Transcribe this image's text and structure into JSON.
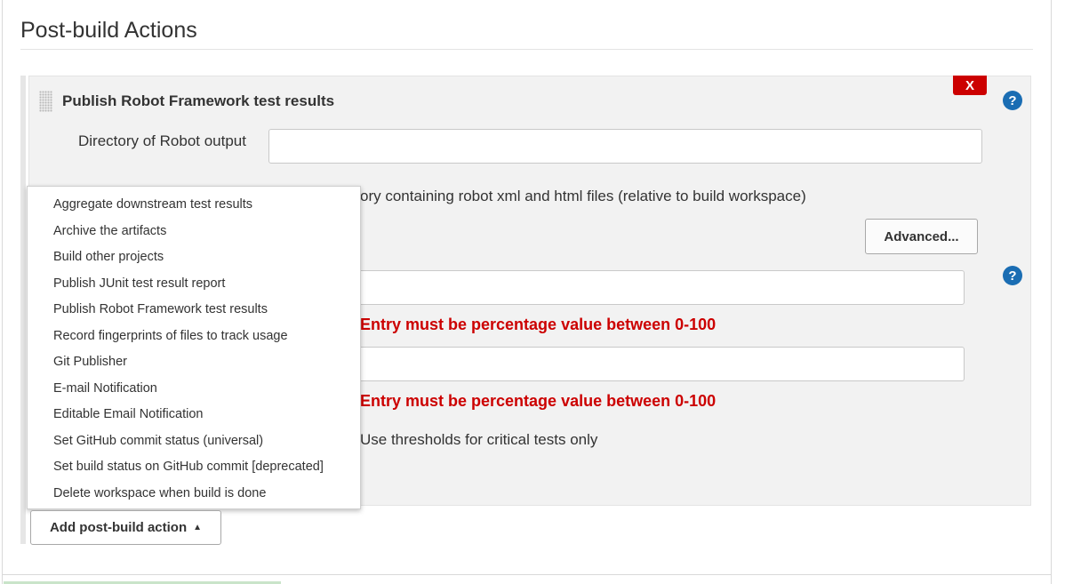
{
  "section": {
    "title": "Post-build Actions"
  },
  "panel": {
    "title": "Publish Robot Framework test results",
    "delete_label": "X",
    "help_symbol": "?",
    "directory_label": "Directory of Robot output",
    "directory_value": "",
    "directory_hint": "ory containing robot xml and html files (relative to build workspace)",
    "advanced_label": "Advanced...",
    "threshold1_value": "",
    "threshold2_value": "",
    "error_text": "Entry must be percentage value between 0-100",
    "critical_label": "Use thresholds for critical tests only"
  },
  "menu": {
    "items": [
      "Aggregate downstream test results",
      "Archive the artifacts",
      "Build other projects",
      "Publish JUnit test result report",
      "Publish Robot Framework test results",
      "Record fingerprints of files to track usage",
      "Git Publisher",
      "E-mail Notification",
      "Editable Email Notification",
      "Set GitHub commit status (universal)",
      "Set build status on GitHub commit [deprecated]",
      "Delete workspace when build is done"
    ]
  },
  "add_button": {
    "label": "Add post-build action",
    "icon": "caret-up-icon"
  },
  "colors": {
    "error": "#cc0000",
    "help": "#1a6db3",
    "delete": "#cc0000"
  }
}
